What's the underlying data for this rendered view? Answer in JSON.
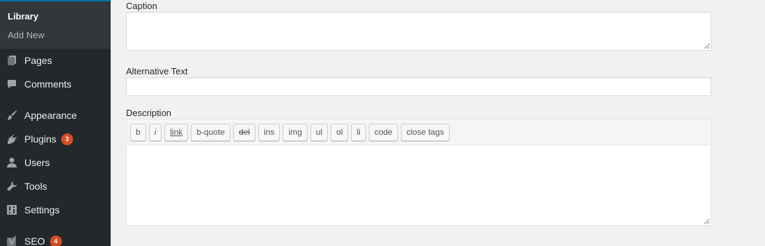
{
  "sidebar": {
    "submenu": [
      {
        "label": "Library",
        "current": true
      },
      {
        "label": "Add New",
        "current": false
      }
    ],
    "items": [
      {
        "label": "Pages",
        "icon": "pages-icon"
      },
      {
        "label": "Comments",
        "icon": "comments-icon"
      },
      {
        "label": "Appearance",
        "icon": "appearance-icon"
      },
      {
        "label": "Plugins",
        "icon": "plugins-icon",
        "badge": "3"
      },
      {
        "label": "Users",
        "icon": "users-icon"
      },
      {
        "label": "Tools",
        "icon": "tools-icon"
      },
      {
        "label": "Settings",
        "icon": "settings-icon"
      },
      {
        "label": "SEO",
        "icon": "seo-icon",
        "badge": "4"
      }
    ]
  },
  "form": {
    "caption_label": "Caption",
    "caption_value": "",
    "alt_label": "Alternative Text",
    "alt_value": "",
    "description_label": "Description",
    "description_value": "",
    "toolbar": [
      "b",
      "i",
      "link",
      "b-quote",
      "del",
      "ins",
      "img",
      "ul",
      "ol",
      "li",
      "code",
      "close tags"
    ]
  },
  "colors": {
    "sidebar_bg": "#23282d",
    "submenu_bg": "#32373c",
    "badge": "#d54e21",
    "page_bg": "#f1f1f1"
  }
}
